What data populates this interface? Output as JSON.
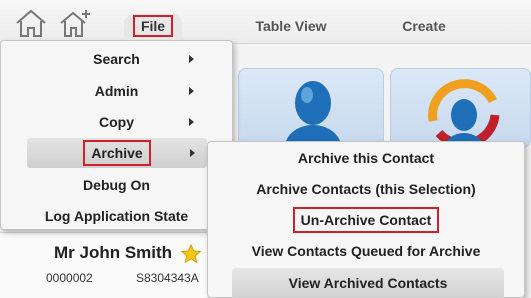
{
  "toolbar": {
    "icons": [
      "home-icon",
      "add-home-icon"
    ],
    "tabs": [
      {
        "label": "File"
      },
      {
        "label": "Table View"
      },
      {
        "label": "Create"
      }
    ]
  },
  "file_menu": {
    "items": [
      {
        "label": "Search",
        "has_submenu": true
      },
      {
        "label": "Admin",
        "has_submenu": true
      },
      {
        "label": "Copy",
        "has_submenu": true
      },
      {
        "label": "Archive",
        "has_submenu": true
      },
      {
        "label": "Debug On",
        "has_submenu": false
      },
      {
        "label": "Log Application State",
        "has_submenu": false
      }
    ]
  },
  "archive_menu": {
    "items": [
      {
        "label": "Archive this Contact"
      },
      {
        "label": "Archive Contacts (this Selection)"
      },
      {
        "label": "Un-Archive Contact"
      },
      {
        "label": "View Contacts Queued for Archive"
      },
      {
        "label": "View Archived Contacts"
      }
    ]
  },
  "contact": {
    "name": "Mr John Smith",
    "id": "0000002",
    "ref": "S8304343A"
  },
  "colors": {
    "highlight": "#d0202a",
    "star": "#f5c518",
    "person": "#1e6fb8"
  }
}
